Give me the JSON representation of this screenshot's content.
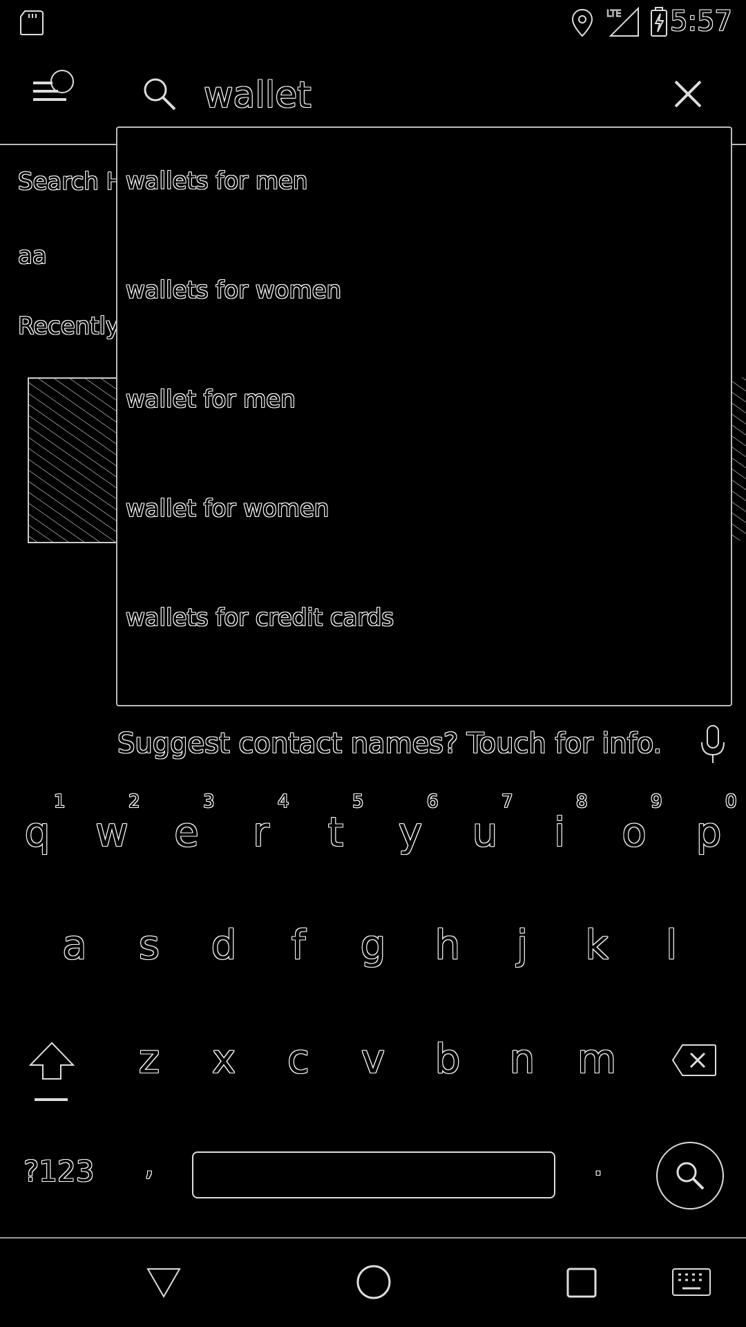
{
  "status_bar": {
    "time": "5:57",
    "network": "LTE",
    "icons": [
      "sd-card-icon",
      "location-icon",
      "lte-signal-icon",
      "battery-charging-icon"
    ]
  },
  "app_bar": {
    "query": "wallet",
    "icons": [
      "menu-icon",
      "search-icon",
      "close-icon"
    ]
  },
  "background": {
    "section_title": "Search H",
    "history_item": "aa",
    "recent_title": "Recently"
  },
  "suggestions": [
    "wallets for men",
    "wallets for women",
    "wallet for men",
    "wallet for women",
    "wallets for credit cards"
  ],
  "keyboard": {
    "suggest_message": "Suggest contact names? Touch for info.",
    "row1": [
      "q",
      "w",
      "e",
      "r",
      "t",
      "y",
      "u",
      "i",
      "o",
      "p"
    ],
    "row1_hints": [
      "1",
      "2",
      "3",
      "4",
      "5",
      "6",
      "7",
      "8",
      "9",
      "0"
    ],
    "row2": [
      "a",
      "s",
      "d",
      "f",
      "g",
      "h",
      "j",
      "k",
      "l"
    ],
    "row3": [
      "z",
      "x",
      "c",
      "v",
      "b",
      "n",
      "m"
    ],
    "symbols_label": "?123",
    "comma": ",",
    "period": "."
  },
  "nav_bar": {
    "icons": [
      "back-icon",
      "home-icon",
      "recents-icon",
      "keyboard-switch-icon"
    ]
  }
}
